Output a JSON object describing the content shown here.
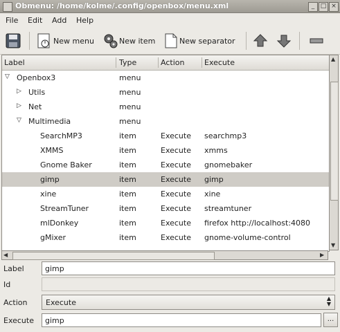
{
  "window": {
    "title": "Obmenu: /home/kolme/.config/openbox/menu.xml"
  },
  "menubar": {
    "file": "File",
    "edit": "Edit",
    "add": "Add",
    "help": "Help"
  },
  "toolbar": {
    "new_menu": "New menu",
    "new_item": "New item",
    "new_separator": "New separator"
  },
  "columns": {
    "label": "Label",
    "type": "Type",
    "action": "Action",
    "execute": "Execute"
  },
  "rows": [
    {
      "label": "Openbox3",
      "type": "menu",
      "action": "",
      "execute": "",
      "level": 0,
      "expander": "open"
    },
    {
      "label": "Utils",
      "type": "menu",
      "action": "",
      "execute": "",
      "level": 1,
      "expander": "closed"
    },
    {
      "label": "Net",
      "type": "menu",
      "action": "",
      "execute": "",
      "level": 1,
      "expander": "closed"
    },
    {
      "label": "Multimedia",
      "type": "menu",
      "action": "",
      "execute": "",
      "level": 1,
      "expander": "open"
    },
    {
      "label": "SearchMP3",
      "type": "item",
      "action": "Execute",
      "execute": "searchmp3",
      "level": 2
    },
    {
      "label": "XMMS",
      "type": "item",
      "action": "Execute",
      "execute": "xmms",
      "level": 2
    },
    {
      "label": "Gnome Baker",
      "type": "item",
      "action": "Execute",
      "execute": "gnomebaker",
      "level": 2
    },
    {
      "label": "gimp",
      "type": "item",
      "action": "Execute",
      "execute": "gimp",
      "level": 2,
      "selected": true
    },
    {
      "label": "xine",
      "type": "item",
      "action": "Execute",
      "execute": "xine",
      "level": 2
    },
    {
      "label": "StreamTuner",
      "type": "item",
      "action": "Execute",
      "execute": "streamtuner",
      "level": 2
    },
    {
      "label": "mlDonkey",
      "type": "item",
      "action": "Execute",
      "execute": "firefox http://localhost:4080",
      "level": 2
    },
    {
      "label": "gMixer",
      "type": "item",
      "action": "Execute",
      "execute": "gnome-volume-control",
      "level": 2
    }
  ],
  "form": {
    "label_caption": "Label",
    "label_value": "gimp",
    "id_caption": "Id",
    "id_value": "",
    "action_caption": "Action",
    "action_value": "Execute",
    "execute_caption": "Execute",
    "execute_value": "gimp",
    "browse_label": "..."
  }
}
